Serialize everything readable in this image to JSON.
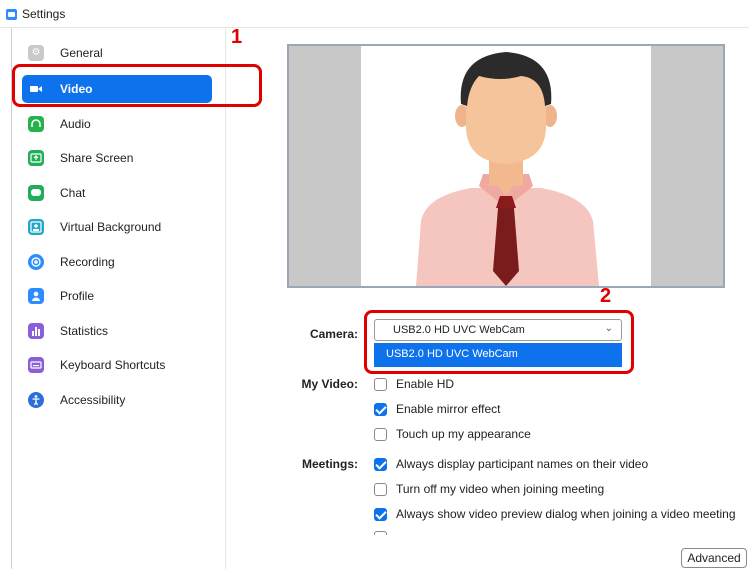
{
  "window": {
    "title": "Settings"
  },
  "sidebar": {
    "items": [
      {
        "label": "General",
        "icon": "gear-icon",
        "color": "#c9c9c9",
        "active": false
      },
      {
        "label": "Video",
        "icon": "video-camera-icon",
        "color": "#0e72ed",
        "active": true
      },
      {
        "label": "Audio",
        "icon": "headphones-icon",
        "color": "#26b24a",
        "active": false
      },
      {
        "label": "Share Screen",
        "icon": "share-screen-icon",
        "color": "#1fae5a",
        "active": false
      },
      {
        "label": "Chat",
        "icon": "chat-bubble-icon",
        "color": "#1fae5a",
        "active": false
      },
      {
        "label": "Virtual Background",
        "icon": "person-background-icon",
        "color": "#22a8c7",
        "active": false
      },
      {
        "label": "Recording",
        "icon": "record-icon",
        "color": "#2d8cff",
        "active": false
      },
      {
        "label": "Profile",
        "icon": "profile-icon",
        "color": "#2d8cff",
        "active": false
      },
      {
        "label": "Statistics",
        "icon": "bar-chart-icon",
        "color": "#8a5fd8",
        "active": false
      },
      {
        "label": "Keyboard Shortcuts",
        "icon": "keyboard-icon",
        "color": "#8a5fd8",
        "active": false
      },
      {
        "label": "Accessibility",
        "icon": "accessibility-icon",
        "color": "#2d6fd8",
        "active": false
      }
    ]
  },
  "annotations": {
    "marker_1": "1",
    "marker_2": "2"
  },
  "camera": {
    "label": "Camera:",
    "selected": "USB2.0 HD UVC WebCam",
    "options": [
      "USB2.0 HD UVC WebCam"
    ]
  },
  "my_video": {
    "label": "My Video:",
    "options": [
      {
        "label": "Enable HD",
        "checked": false
      },
      {
        "label": "Enable mirror effect",
        "checked": true
      },
      {
        "label": "Touch up my appearance",
        "checked": false
      }
    ]
  },
  "meetings": {
    "label": "Meetings:",
    "options": [
      {
        "label": "Always display participant names on their video",
        "checked": true
      },
      {
        "label": "Turn off my video when joining meeting",
        "checked": false
      },
      {
        "label": "Always show video preview dialog when joining a video meeting",
        "checked": true
      }
    ]
  },
  "buttons": {
    "advanced": "Advanced"
  },
  "colors": {
    "accent": "#0e72ed",
    "annotation_red": "#e00000"
  }
}
